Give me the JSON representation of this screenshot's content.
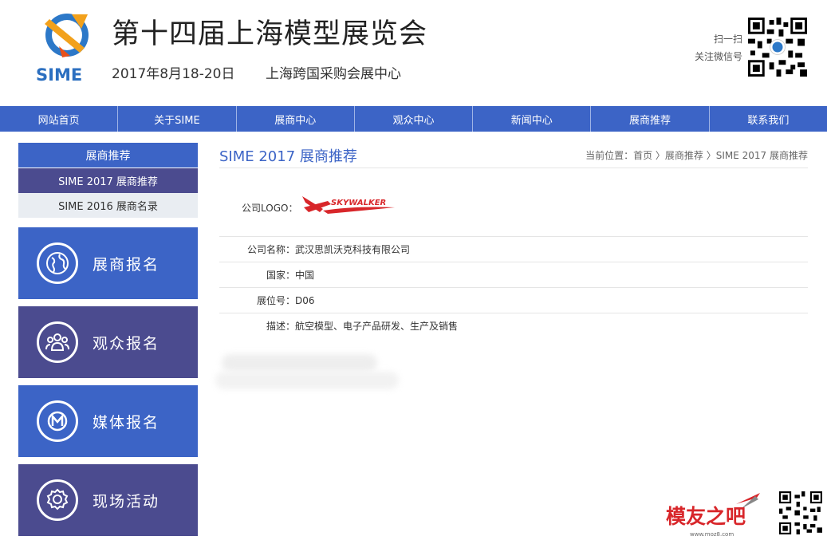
{
  "header": {
    "logo_text": "SIME",
    "title": "第十四届上海模型展览会",
    "date": "2017年8月18-20日",
    "venue": "上海跨国采购会展中心",
    "wechat_line1": "扫一扫",
    "wechat_line2": "关注微信号"
  },
  "nav": {
    "items": [
      {
        "label": "网站首页"
      },
      {
        "label": "关于SIME"
      },
      {
        "label": "展商中心"
      },
      {
        "label": "观众中心"
      },
      {
        "label": "新闻中心"
      },
      {
        "label": "展商推荐"
      },
      {
        "label": "联系我们"
      }
    ]
  },
  "sidebar": {
    "header": "展商推荐",
    "items": [
      {
        "label": "SIME 2017 展商推荐"
      },
      {
        "label": "SIME 2016 展商名录"
      }
    ],
    "registrations": [
      {
        "label": "展商报名",
        "icon": "globe-icon"
      },
      {
        "label": "观众报名",
        "icon": "people-icon"
      },
      {
        "label": "媒体报名",
        "icon": "media-m-icon"
      },
      {
        "label": "现场活动",
        "icon": "badge-icon"
      }
    ]
  },
  "main": {
    "title": "SIME 2017 展商推荐",
    "breadcrumb": "当前位置：首页 〉展商推荐 〉SIME 2017 展商推荐",
    "logo_label": "公司LOGO：",
    "company_logo_text": "SKYWALKER",
    "rows": [
      {
        "label": "公司名称：",
        "value": "武汉思凯沃克科技有限公司"
      },
      {
        "label": "国家：",
        "value": "中国"
      },
      {
        "label": "展位号：",
        "value": "D06"
      },
      {
        "label": "描述：",
        "value": "航空模型、电子产品研发、生产及销售"
      }
    ]
  },
  "watermark": {
    "text": "模友之吧",
    "url": "www.moz8.com"
  },
  "colors": {
    "primary": "#3c64c6",
    "secondary": "#4b4b8f",
    "sub_bg": "#e9edf2"
  }
}
